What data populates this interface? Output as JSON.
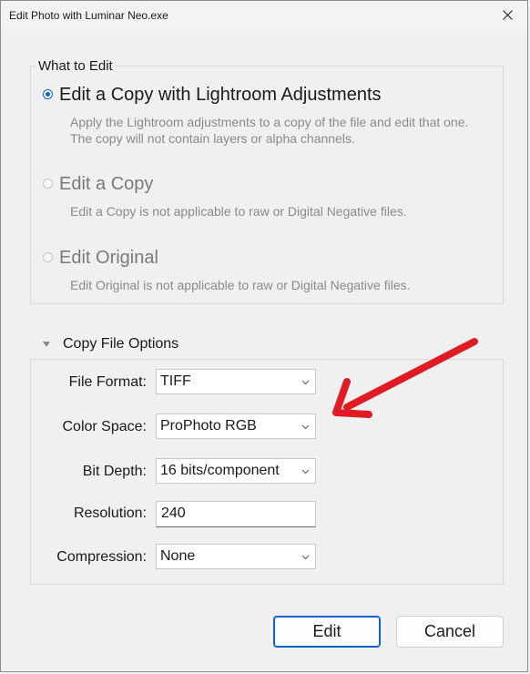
{
  "window": {
    "title": "Edit Photo with Luminar Neo.exe"
  },
  "what_to_edit": {
    "group_title": "What to Edit",
    "options": [
      {
        "label": "Edit a Copy with Lightroom Adjustments",
        "desc_line1": "Apply the Lightroom adjustments to a copy of the file and edit that one.",
        "desc_line2": "The copy will not contain layers or alpha channels.",
        "selected": true,
        "enabled": true
      },
      {
        "label": "Edit a Copy",
        "desc_line1": "Edit a Copy is not applicable to raw or Digital Negative files.",
        "selected": false,
        "enabled": false
      },
      {
        "label": "Edit Original",
        "desc_line1": "Edit Original is not applicable to raw or Digital Negative files.",
        "selected": false,
        "enabled": false
      }
    ]
  },
  "copy_file_options": {
    "section_title": "Copy File Options",
    "expanded": true,
    "file_format": {
      "label": "File Format:",
      "value": "TIFF"
    },
    "color_space": {
      "label": "Color Space:",
      "value": "ProPhoto RGB"
    },
    "bit_depth": {
      "label": "Bit Depth:",
      "value": "16 bits/component"
    },
    "resolution": {
      "label": "Resolution:",
      "value": "240"
    },
    "compression": {
      "label": "Compression:",
      "value": "None"
    }
  },
  "buttons": {
    "edit_label": "Edit",
    "cancel_label": "Cancel"
  },
  "colors": {
    "accent": "#0a64c8",
    "annotation_arrow": "#e01b24"
  },
  "icons": {
    "close": "close-icon",
    "disclosure": "triangle-down-icon",
    "dropdown": "chevron-down-icon",
    "annotation": "red-arrow-annotation"
  }
}
